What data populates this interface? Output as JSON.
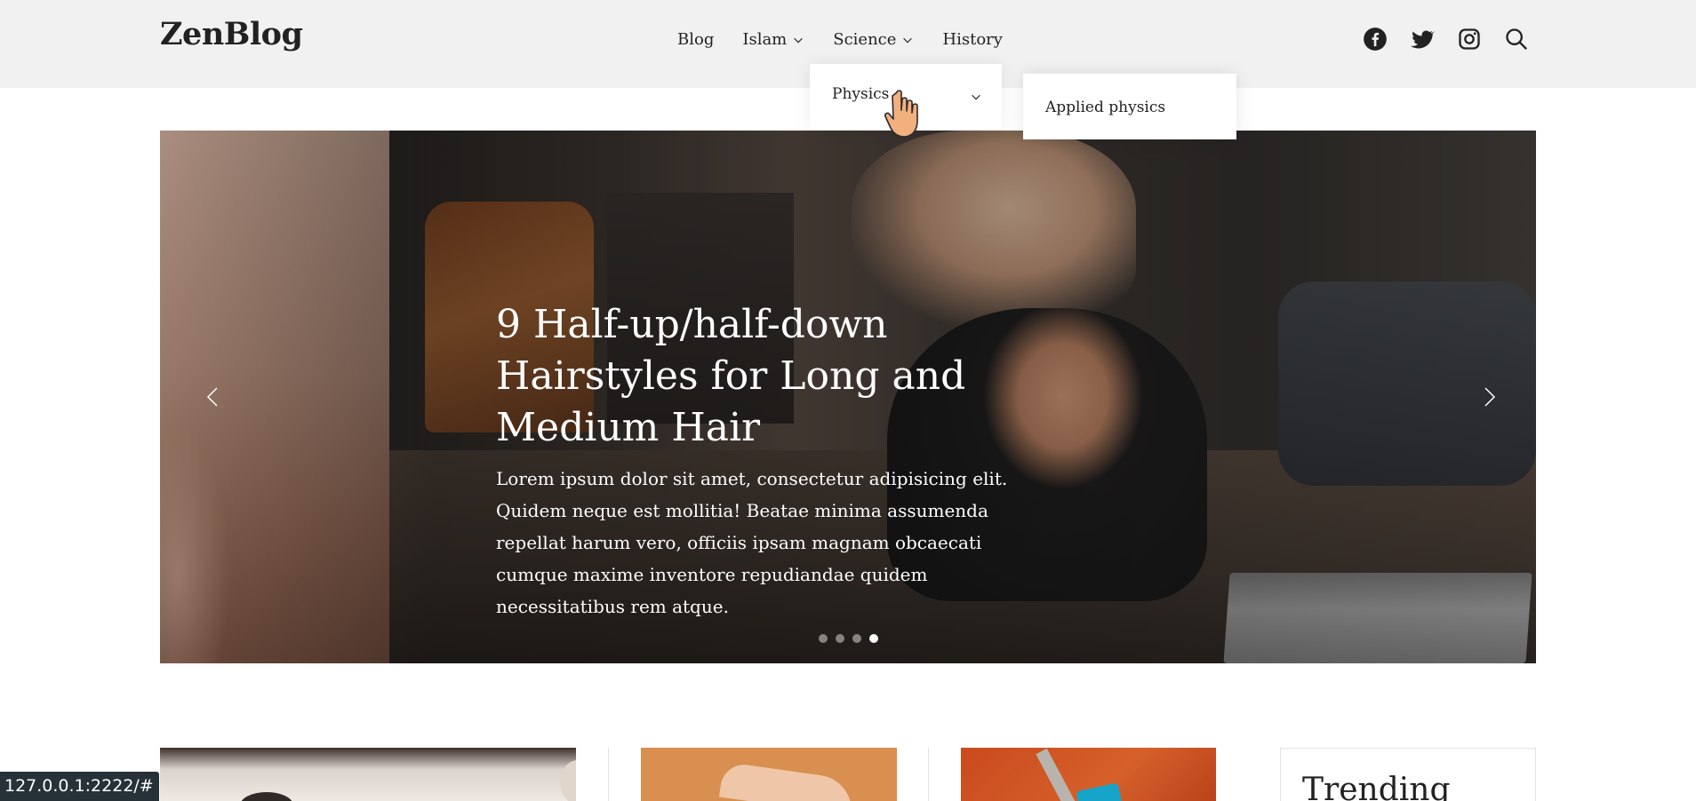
{
  "header": {
    "logo": "ZenBlog",
    "nav": [
      {
        "label": "Blog",
        "has_dropdown": false
      },
      {
        "label": "Islam",
        "has_dropdown": true
      },
      {
        "label": "Science",
        "has_dropdown": true
      },
      {
        "label": "History",
        "has_dropdown": false
      }
    ],
    "social_icons": [
      "facebook-icon",
      "twitter-icon",
      "instagram-icon",
      "search-icon"
    ]
  },
  "dropdown": {
    "item": "Physics",
    "submenu_item": "Applied physics"
  },
  "hero": {
    "title": "9 Half-up/half-down Hairstyles for Long and Medium Hair",
    "text": "Lorem ipsum dolor sit amet, consectetur adipisicing elit. Quidem neque est mollitia! Beatae minima assumenda repellat harum vero, officiis ipsam magnam obcaecati cumque maxime inventore repudiandae quidem necessitatibus rem atque.",
    "slide_count": 4,
    "active_slide": 4
  },
  "trending": {
    "title": "Trending"
  },
  "statusbar": {
    "url": "127.0.0.1:2222/#"
  },
  "colors": {
    "header_bg": "#f1f1f1",
    "text": "#222222",
    "statusbar_bg": "#263238"
  }
}
